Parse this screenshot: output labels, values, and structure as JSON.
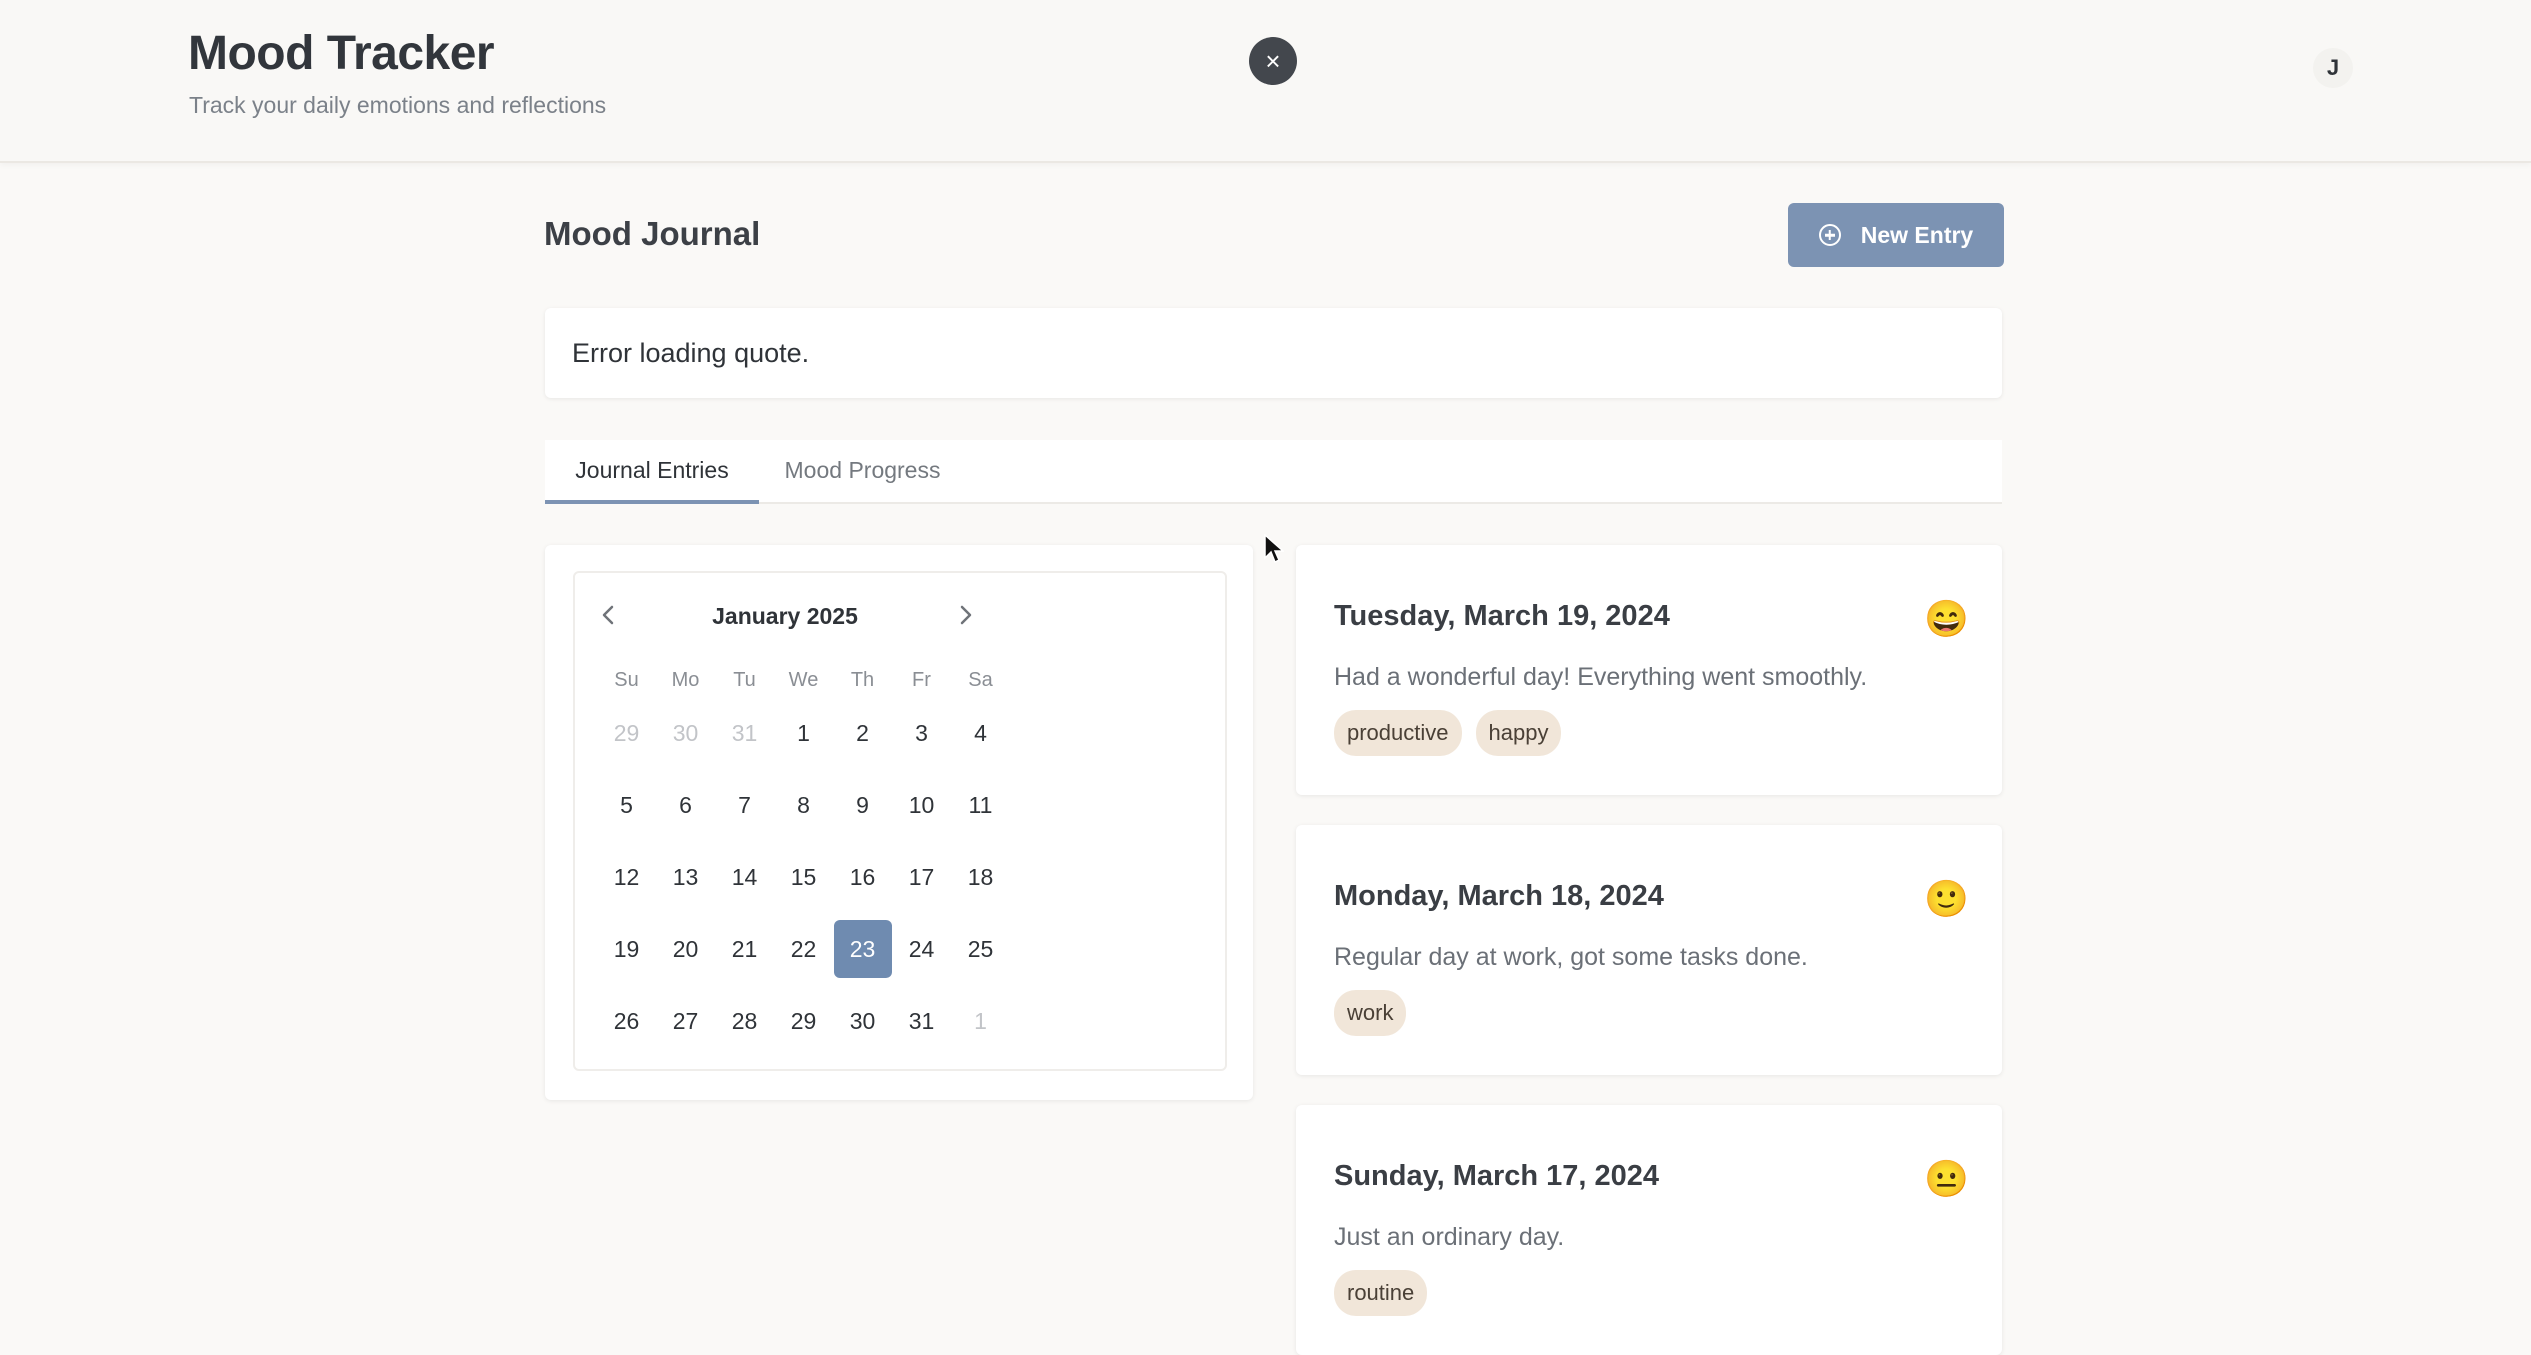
{
  "header": {
    "title": "Mood Tracker",
    "subtitle": "Track your daily emotions and reflections",
    "close_label": "×",
    "avatar_initial": "J"
  },
  "main": {
    "page_title": "Mood Journal",
    "new_entry_label": "New Entry",
    "quote_text": "Error loading quote.",
    "tabs": [
      {
        "label": "Journal Entries",
        "active": true
      },
      {
        "label": "Mood Progress",
        "active": false
      }
    ]
  },
  "calendar": {
    "month_label": "January 2025",
    "prev_icon": "chevron-left-icon",
    "next_icon": "chevron-right-icon",
    "weekdays": [
      "Su",
      "Mo",
      "Tu",
      "We",
      "Th",
      "Fr",
      "Sa"
    ],
    "selected_day": "23",
    "weeks": [
      [
        "29",
        "30",
        "31",
        "1",
        "2",
        "3",
        "4"
      ],
      [
        "5",
        "6",
        "7",
        "8",
        "9",
        "10",
        "11"
      ],
      [
        "12",
        "13",
        "14",
        "15",
        "16",
        "17",
        "18"
      ],
      [
        "19",
        "20",
        "21",
        "22",
        "23",
        "24",
        "25"
      ],
      [
        "26",
        "27",
        "28",
        "29",
        "30",
        "31",
        "1"
      ]
    ],
    "outside_days": [
      [
        0,
        0
      ],
      [
        0,
        1
      ],
      [
        0,
        2
      ],
      [
        4,
        6
      ]
    ]
  },
  "entries": [
    {
      "date": "Tuesday, March 19, 2024",
      "emoji": "😄",
      "text": "Had a wonderful day! Everything went smoothly.",
      "tags": [
        "productive",
        "happy"
      ]
    },
    {
      "date": "Monday, March 18, 2024",
      "emoji": "🙂",
      "text": "Regular day at work, got some tasks done.",
      "tags": [
        "work"
      ]
    },
    {
      "date": "Sunday, March 17, 2024",
      "emoji": "😐",
      "text": "Just an ordinary day.",
      "tags": [
        "routine"
      ]
    }
  ],
  "colors": {
    "accent": "#7c93b3",
    "selected_day": "#6f8bb0",
    "tag_bg": "#f1e6d9",
    "background": "#faf9f7"
  }
}
